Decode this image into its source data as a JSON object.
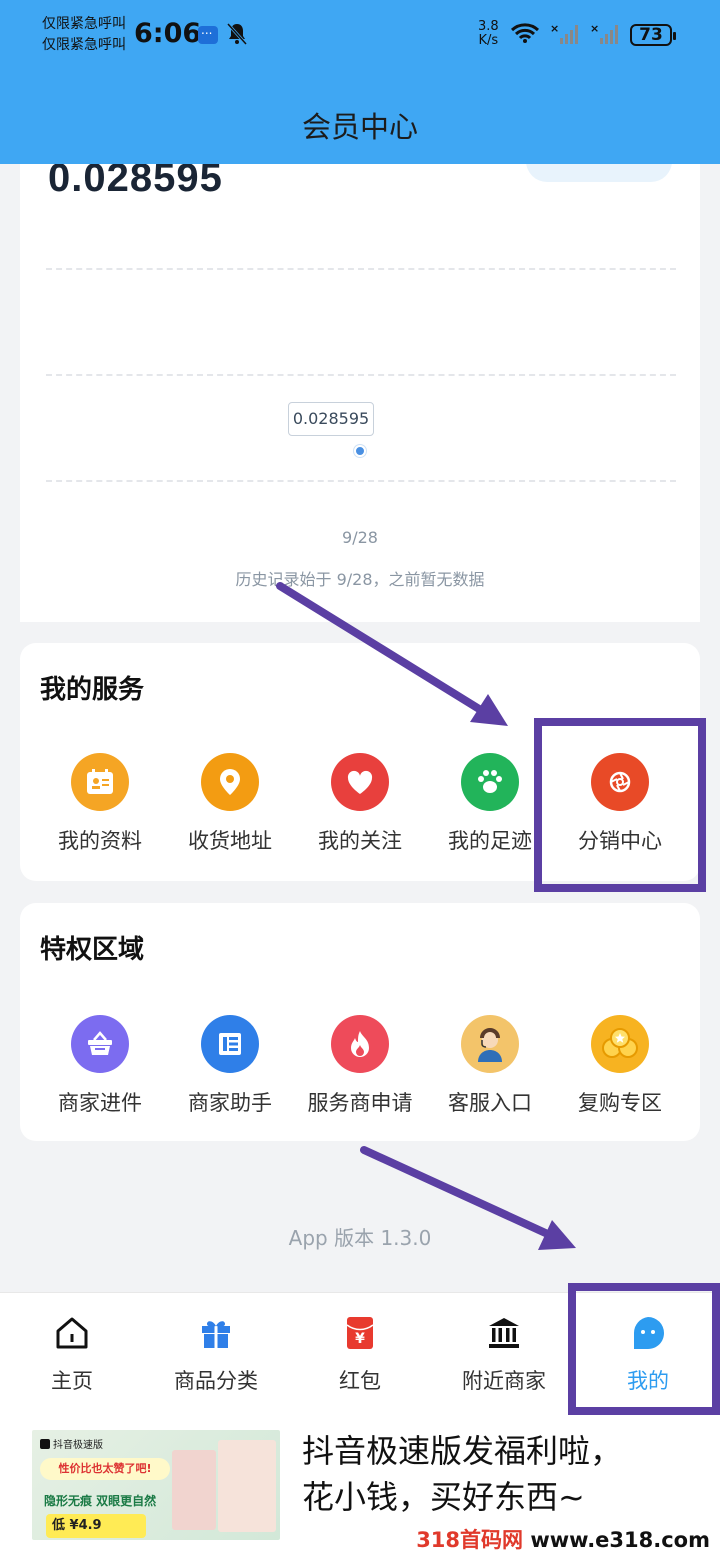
{
  "status_bar": {
    "carrier_line1": "仅限紧急呼叫",
    "carrier_line2": "仅限紧急呼叫",
    "time": "6:06",
    "net_speed_value": "3.8",
    "net_speed_unit": "K/s",
    "battery": "73",
    "icons": [
      "message-icon",
      "bell-muted-icon",
      "wifi-icon",
      "signal-icon",
      "signal-icon",
      "battery-icon"
    ]
  },
  "header": {
    "title": "会员中心"
  },
  "chart": {
    "big_value": "0.028595",
    "tooltip": "0.028595",
    "x_label": "9/28",
    "note": "历史记录始于 9/28，之前暂无数据"
  },
  "chart_data": {
    "type": "line",
    "x": [
      "9/28"
    ],
    "series": [
      {
        "values": [
          0.028595
        ]
      }
    ]
  },
  "services": {
    "title": "我的服务",
    "items": [
      {
        "label": "我的资料",
        "icon": "profile-card-icon",
        "color": "#f5a524"
      },
      {
        "label": "收货地址",
        "icon": "location-pin-icon",
        "color": "#f39c12"
      },
      {
        "label": "我的关注",
        "icon": "heart-icon",
        "color": "#e8403d"
      },
      {
        "label": "我的足迹",
        "icon": "paw-icon",
        "color": "#22b45a"
      },
      {
        "label": "分销中心",
        "icon": "distribution-icon",
        "color": "#e84a27"
      }
    ]
  },
  "privileges": {
    "title": "特权区域",
    "items": [
      {
        "label": "商家进件",
        "icon": "basket-icon",
        "color": "#7c6cf0"
      },
      {
        "label": "商家助手",
        "icon": "list-icon",
        "color": "#2f7fe8"
      },
      {
        "label": "服务商申请",
        "icon": "flame-icon",
        "color": "#ee4b5a"
      },
      {
        "label": "客服入口",
        "icon": "customer-service-icon",
        "color": "#f3b03d"
      },
      {
        "label": "复购专区",
        "icon": "coins-icon",
        "color": "#f7b321"
      }
    ]
  },
  "version": "App 版本 1.3.0",
  "bottom_nav": {
    "items": [
      {
        "label": "主页",
        "icon": "home-icon"
      },
      {
        "label": "商品分类",
        "icon": "gift-icon"
      },
      {
        "label": "红包",
        "icon": "red-envelope-icon"
      },
      {
        "label": "附近商家",
        "icon": "bank-icon"
      },
      {
        "label": "我的",
        "icon": "chat-bubble-icon"
      }
    ],
    "active_index": 4,
    "active_color": "#2d9cf0"
  },
  "ad": {
    "brand": "抖音极速版",
    "sticker": "性价比也太赞了吧!",
    "product_line": "隐形无痕 双眼更自然",
    "price": "低 ¥4.9",
    "headline_line1": "抖音极速版发福利啦，",
    "headline_line2": "花小钱，买好东西~"
  },
  "watermark": {
    "part1": "318首码网",
    "part2": " www.e318.com"
  },
  "colors": {
    "header_bg": "#3fa7f3",
    "annotation": "#5b3fa3"
  }
}
